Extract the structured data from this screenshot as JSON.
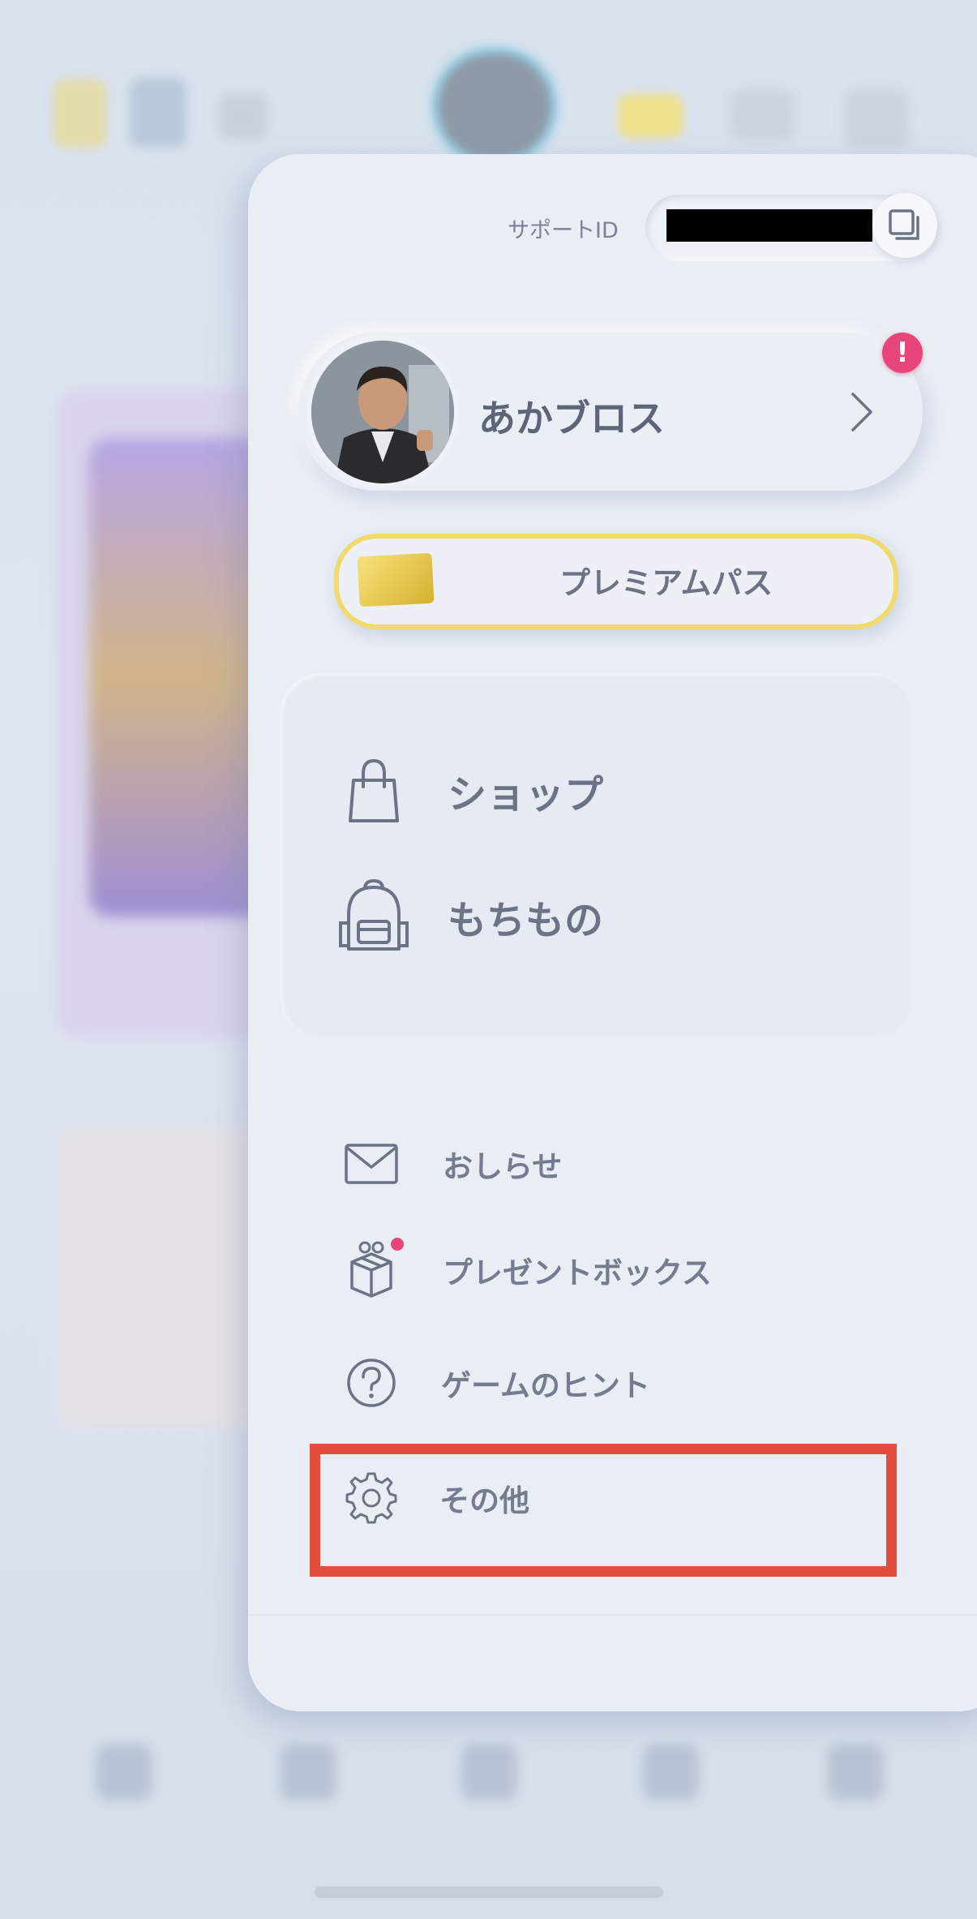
{
  "drawer": {
    "support_label": "サポートID",
    "profile": {
      "name": "あかブロス",
      "alert": "!"
    },
    "premium_pass_label": "プレミアムパス",
    "main_menu": [
      {
        "label": "ショップ",
        "icon": "shopping-bag-icon"
      },
      {
        "label": "もちもの",
        "icon": "backpack-icon"
      }
    ],
    "secondary_menu": [
      {
        "label": "おしらせ",
        "icon": "envelope-icon"
      },
      {
        "label": "プレゼントボックス",
        "icon": "gift-icon"
      },
      {
        "label": "ゲームのヒント",
        "icon": "question-icon"
      },
      {
        "label": "その他",
        "icon": "gear-icon"
      }
    ]
  },
  "colors": {
    "highlight": "#e24d3d",
    "badge": "#e8457a",
    "premium_border": "#f2d96e"
  }
}
